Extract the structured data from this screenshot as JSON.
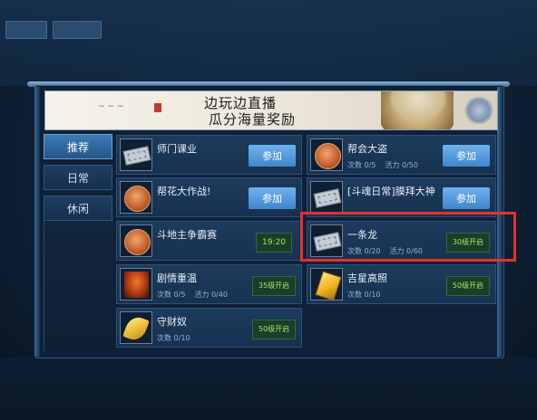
{
  "banner": {
    "line1": "边玩边直播",
    "line2": "瓜分海量奖励"
  },
  "tabs": [
    {
      "label": "推荐",
      "active": true
    },
    {
      "label": "日常",
      "active": false
    },
    {
      "label": "休闲",
      "active": false
    }
  ],
  "activities": {
    "left": [
      {
        "name": "师门课业",
        "icon": "ticket-icon",
        "action": "参加"
      },
      {
        "name": "帮花大作战!",
        "icon": "coin-icon",
        "action": "参加"
      },
      {
        "name": "斗地主争霸赛",
        "icon": "coin-icon",
        "time": "19:20"
      },
      {
        "name": "剧情重温",
        "icon": "demon-icon",
        "count": "次数 0/5",
        "vitality": "活力 0/40",
        "tag": "35级开启"
      },
      {
        "name": "守财奴",
        "icon": "leaf-icon",
        "count": "次数 0/10",
        "tag": "50级开启"
      }
    ],
    "right": [
      {
        "name": "帮会大盗",
        "icon": "coin-icon",
        "count": "次数 0/5",
        "vitality": "活力 0/50",
        "action": "参加"
      },
      {
        "name": "[斗魂日常]膜拜大神",
        "icon": "ticket-icon",
        "action": "参加"
      },
      {
        "name": "一条龙",
        "icon": "ticket-icon",
        "count": "次数 0/20",
        "vitality": "活力 0/60",
        "tag": "30级开启"
      },
      {
        "name": "吉星高照",
        "icon": "book-icon",
        "count": "次数 0/10",
        "tag": "50级开启"
      }
    ]
  },
  "colors": {
    "highlight": "#e8302c",
    "join_button": "#4f96d8",
    "tag_text": "#9ee86a"
  }
}
